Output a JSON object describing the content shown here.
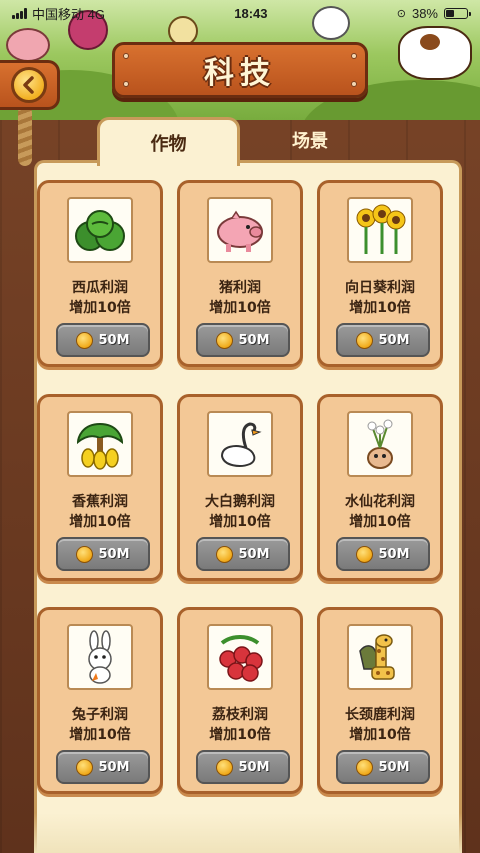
{
  "status_bar": {
    "carrier": "中国移动 4G",
    "time": "18:43",
    "battery": "38%",
    "battery_level": 0.38
  },
  "header": {
    "title": "科技",
    "back_icon": "chevron-left-icon"
  },
  "tabs": [
    {
      "label": "作物",
      "active": true
    },
    {
      "label": "场景",
      "active": false
    }
  ],
  "cards": [
    {
      "name": "西瓜利润",
      "desc": "增加10倍",
      "price": "50M",
      "icon": "watermelon-icon"
    },
    {
      "name": "猪利润",
      "desc": "增加10倍",
      "price": "50M",
      "icon": "pig-icon"
    },
    {
      "name": "向日葵利润",
      "desc": "增加10倍",
      "price": "50M",
      "icon": "sunflower-icon"
    },
    {
      "name": "香蕉利润",
      "desc": "增加10倍",
      "price": "50M",
      "icon": "banana-icon"
    },
    {
      "name": "大白鹅利润",
      "desc": "增加10倍",
      "price": "50M",
      "icon": "goose-icon"
    },
    {
      "name": "水仙花利润",
      "desc": "增加10倍",
      "price": "50M",
      "icon": "narcissus-icon"
    },
    {
      "name": "兔子利润",
      "desc": "增加10倍",
      "price": "50M",
      "icon": "rabbit-icon"
    },
    {
      "name": "荔枝利润",
      "desc": "增加10倍",
      "price": "50M",
      "icon": "lychee-icon"
    },
    {
      "name": "长颈鹿利润",
      "desc": "增加10倍",
      "price": "50M",
      "icon": "giraffe-icon"
    }
  ],
  "colors": {
    "plank": "#c45f25",
    "panel": "#fbf1d2",
    "card": "#f3c896",
    "price_button": "#8a8a8a",
    "coin": "#f0a919"
  }
}
